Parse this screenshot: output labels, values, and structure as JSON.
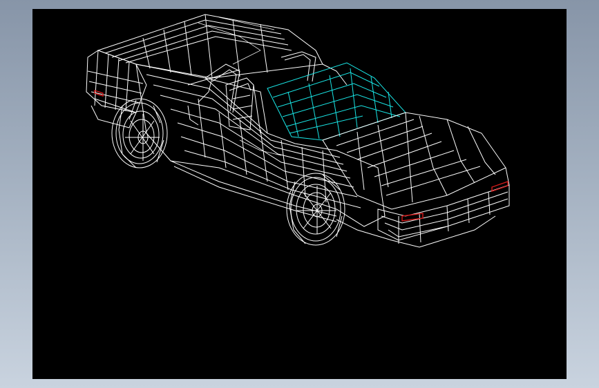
{
  "viewport": {
    "background": "#000000",
    "wire_color": "#ffffff",
    "windshield_color": "#19e6e6",
    "taillight_color": "#d21a1a"
  },
  "model": {
    "icon": "sports-car-wireframe-icon"
  }
}
